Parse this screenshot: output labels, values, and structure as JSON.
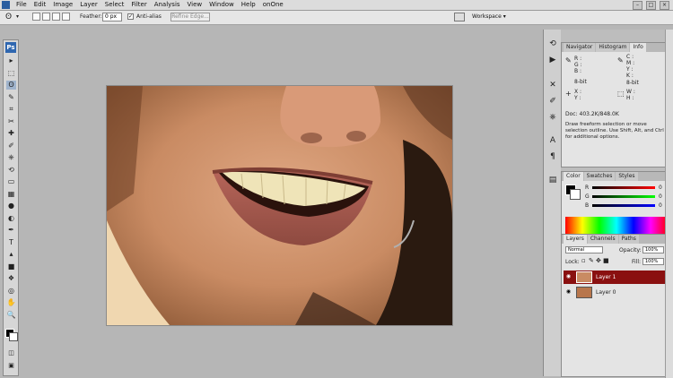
{
  "menubar": {
    "items": [
      "File",
      "Edit",
      "Image",
      "Layer",
      "Select",
      "Filter",
      "Analysis",
      "View",
      "Window",
      "Help",
      "onOne"
    ]
  },
  "options": {
    "feather_label": "Feather:",
    "feather_value": "0 px",
    "antialias_label": "Anti-alias",
    "antialias_mark": "✓",
    "refine_label": "Refine Edge...",
    "workspace_label": "Workspace ▾"
  },
  "toolbox": {
    "logo": "Ps",
    "tools": [
      "move-tool",
      "marquee-tool",
      "lasso-tool",
      "quick-select-tool",
      "crop-tool",
      "slice-tool",
      "healing-brush-tool",
      "brush-tool",
      "clone-stamp-tool",
      "history-brush-tool",
      "eraser-tool",
      "gradient-tool",
      "blur-tool",
      "dodge-tool",
      "pen-tool",
      "type-tool",
      "path-select-tool",
      "shape-tool",
      "3d-rotate-tool",
      "3d-orbit-tool",
      "hand-tool",
      "zoom-tool"
    ],
    "glyphs": [
      "▸",
      "⬚",
      "ʘ",
      "✎",
      "⌗",
      "✂",
      "✚",
      "✐",
      "⎈",
      "⟲",
      "▭",
      "▦",
      "●",
      "◐",
      "✒",
      "T",
      "▴",
      "■",
      "❖",
      "◎",
      "✋",
      "🔍"
    ]
  },
  "info_panel": {
    "tabs": [
      "Navigator",
      "Histogram",
      "Info"
    ],
    "rgb_labels": [
      "R :",
      "G :",
      "B :"
    ],
    "cmyk_labels": [
      "C :",
      "M :",
      "Y :",
      "K :"
    ],
    "bit_left": "8-bit",
    "bit_right": "8-bit",
    "xy_labels": [
      "X :",
      "Y :"
    ],
    "wh_labels": [
      "W :",
      "H :"
    ],
    "doc": "Doc: 403.2K/848.0K",
    "hint": "Draw freeform selection or move selection outline. Use Shift, Alt, and Ctrl for additional options."
  },
  "color_panel": {
    "tabs": [
      "Color",
      "Swatches",
      "Styles"
    ],
    "channels": [
      "R",
      "G",
      "B"
    ],
    "values": [
      "0",
      "0",
      "0"
    ],
    "colors": {
      "r": "#cc2a2a",
      "g": "#2a9a2a",
      "b": "#2a3acc"
    }
  },
  "layers_panel": {
    "tabs": [
      "Layers",
      "Channels",
      "Paths"
    ],
    "blend_mode": "Normal",
    "opacity_label": "Opacity:",
    "opacity_value": "100%",
    "lock_label": "Lock:",
    "fill_label": "Fill:",
    "fill_value": "100%",
    "layers": [
      {
        "name": "Layer 1",
        "selected": true
      },
      {
        "name": "Layer 0",
        "selected": false
      }
    ]
  }
}
